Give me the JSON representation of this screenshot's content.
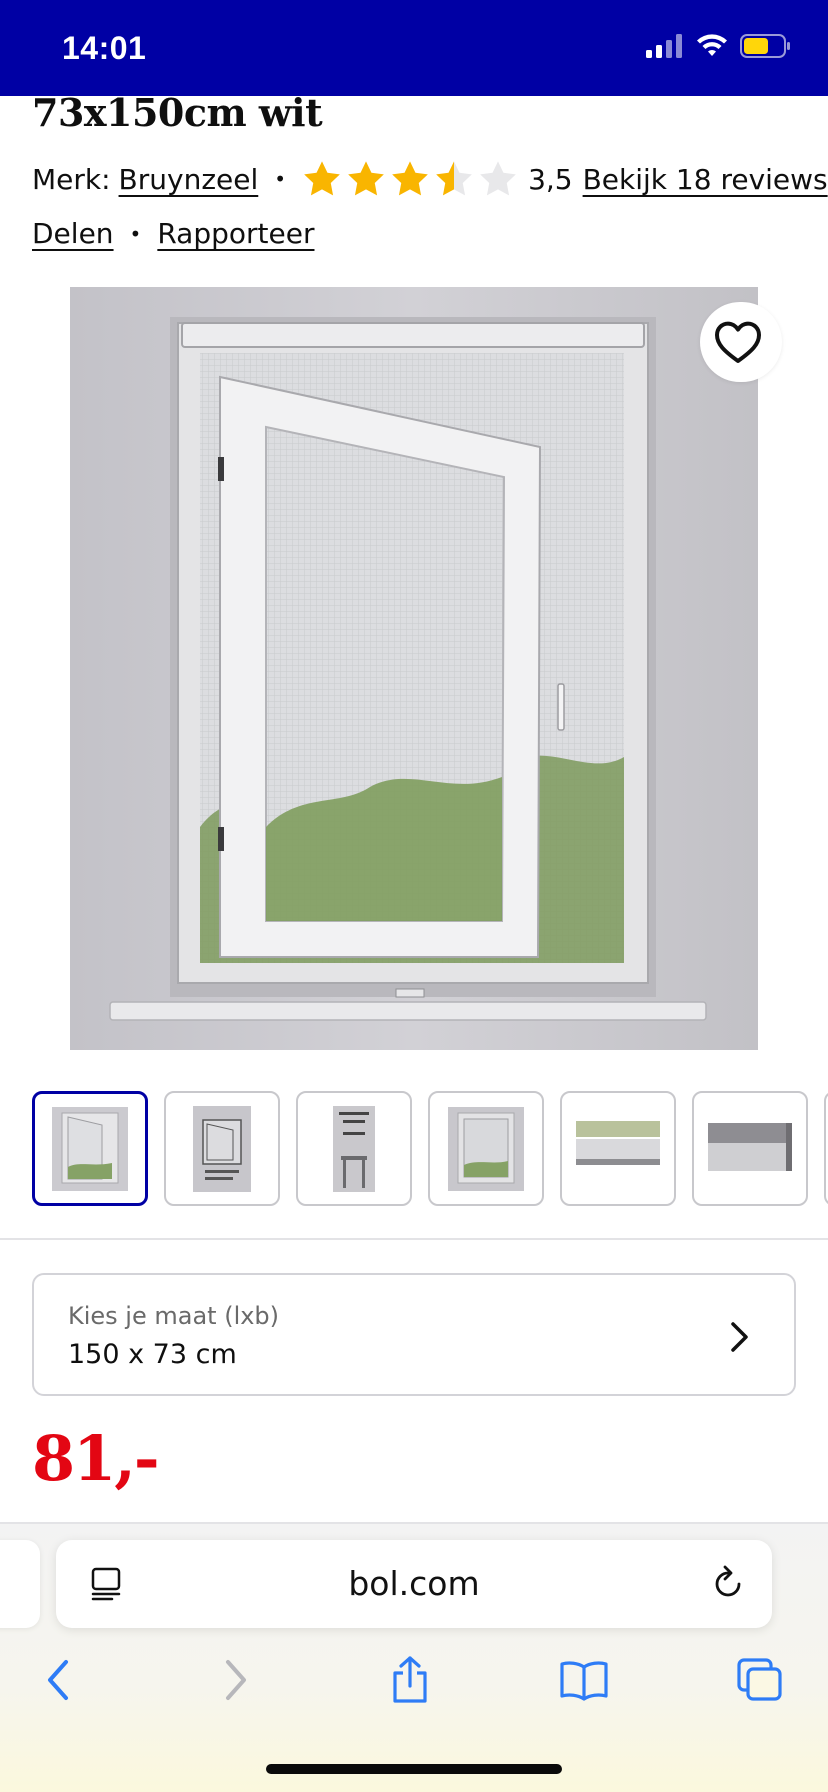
{
  "status_bar": {
    "time": "14:01"
  },
  "product": {
    "title": "73x150cm wit",
    "brand_label": "Merk:",
    "brand": "Bruynzeel",
    "rating": 3.5,
    "rating_text": "3,5",
    "reviews_link": "Bekijk 18 reviews",
    "share_link": "Delen",
    "report_link": "Rapporteer",
    "thumbnail_count": 6
  },
  "size_selector": {
    "label": "Kies je maat (lxb)",
    "value": "150 x 73 cm"
  },
  "price": "81,-",
  "browser": {
    "url": "bol.com"
  },
  "icons": {
    "favorite": "heart-icon",
    "reader": "reader-mode-icon",
    "reload": "reload-icon",
    "back": "back-icon",
    "forward": "forward-icon",
    "share": "share-icon",
    "bookmarks": "bookmarks-icon",
    "tabs": "tabs-icon"
  },
  "colors": {
    "brand_blue": "#0000a4",
    "price_red": "#e30613",
    "star_yellow": "#f9b500",
    "ios_blue": "#1a73e8"
  }
}
